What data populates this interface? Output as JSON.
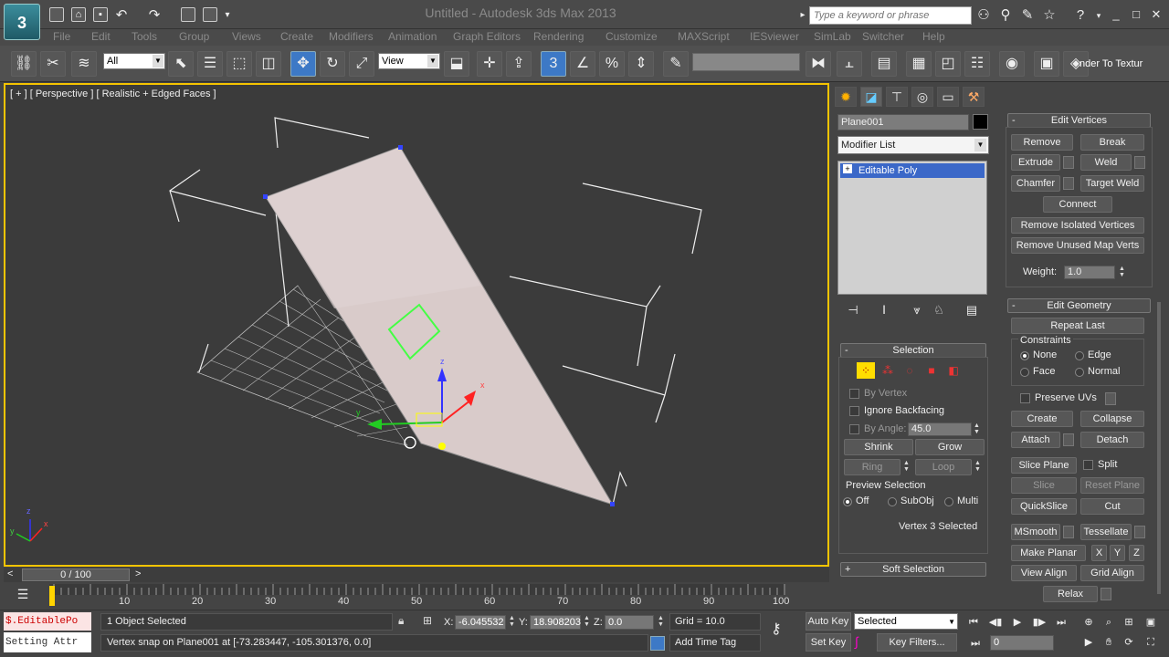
{
  "titlebar": {
    "app_logo": "3",
    "window_title": "Untitled - Autodesk 3ds Max 2013",
    "search_placeholder": "Type a keyword or phrase"
  },
  "menu": [
    "File",
    "Edit",
    "Tools",
    "Group",
    "Views",
    "Create",
    "Modifiers",
    "Animation",
    "Graph Editors",
    "Rendering",
    "Customize",
    "MAXScript",
    "IESviewer",
    "SimLab",
    "Switcher",
    "Help"
  ],
  "toolbar": {
    "selection_filter": "All",
    "ref_coord": "View",
    "snap_toggle_label": "3",
    "render_label": "nder To Textur"
  },
  "viewport": {
    "label": "[ + ] [ Perspective ] [ Realistic + Edged Faces ]",
    "axis_x": "x",
    "axis_y": "y",
    "axis_z": "z"
  },
  "command_panel": {
    "object_name": "Plane001",
    "object_color": "#000000",
    "modifier_list": "Modifier List",
    "stack_item": "Editable Poly",
    "selection": {
      "title": "Selection",
      "by_vertex": "By Vertex",
      "ignore_backfacing": "Ignore Backfacing",
      "by_angle": "By Angle:",
      "angle_value": "45.0",
      "shrink": "Shrink",
      "grow": "Grow",
      "ring": "Ring",
      "loop": "Loop",
      "preview_selection": "Preview Selection",
      "preview_off": "Off",
      "preview_subobj": "SubObj",
      "preview_multi": "Multi",
      "status": "Vertex 3 Selected"
    },
    "soft_selection": "Soft Selection",
    "edit_vertices": {
      "title": "Edit Vertices",
      "remove": "Remove",
      "break": "Break",
      "extrude": "Extrude",
      "weld": "Weld",
      "chamfer": "Chamfer",
      "target_weld": "Target Weld",
      "connect": "Connect",
      "remove_isolated": "Remove Isolated Vertices",
      "remove_unused": "Remove Unused Map Verts",
      "weight_label": "Weight:",
      "weight_value": "1.0"
    },
    "edit_geometry": {
      "title": "Edit Geometry",
      "repeat_last": "Repeat Last",
      "constraints": "Constraints",
      "none": "None",
      "edge": "Edge",
      "face": "Face",
      "normal": "Normal",
      "preserve_uvs": "Preserve UVs",
      "create": "Create",
      "collapse": "Collapse",
      "attach": "Attach",
      "detach": "Detach",
      "slice_plane": "Slice Plane",
      "split": "Split",
      "slice": "Slice",
      "reset_plane": "Reset Plane",
      "quickslice": "QuickSlice",
      "cut": "Cut",
      "msmooth": "MSmooth",
      "tessellate": "Tessellate",
      "make_planar": "Make Planar",
      "x": "X",
      "y": "Y",
      "z": "Z",
      "view_align": "View Align",
      "grid_align": "Grid Align",
      "relax": "Relax"
    }
  },
  "timeline": {
    "time_slider": "0 / 100",
    "ticks": [
      "10",
      "20",
      "30",
      "40",
      "50",
      "60",
      "70",
      "80",
      "90",
      "100"
    ]
  },
  "status": {
    "maxscript_top": "$.EditablePo",
    "maxscript_bottom": "Setting Attr",
    "status_line": "1 Object Selected",
    "prompt_line": "Vertex snap on Plane001 at [-73.283447, -105.301376, 0.0]",
    "x_label": "X:",
    "x_value": "-6.045532",
    "y_label": "Y:",
    "y_value": "18.908203",
    "z_label": "Z:",
    "z_value": "0.0",
    "grid": "Grid = 10.0",
    "add_time_tag": "Add Time Tag",
    "auto_key": "Auto Key",
    "set_key": "Set Key",
    "selected": "Selected",
    "key_filters": "Key Filters...",
    "frame": "0"
  }
}
